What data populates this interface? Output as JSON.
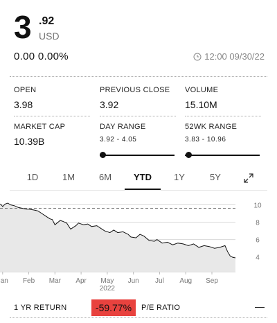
{
  "quote": {
    "price_whole": "3",
    "price_cents": ".92",
    "currency": "USD",
    "change": "0.00 0.00%",
    "timestamp": "12:00 09/30/22"
  },
  "stats": {
    "open": {
      "label": "OPEN",
      "value": "3.98"
    },
    "previous_close": {
      "label": "PREVIOUS CLOSE",
      "value": "3.92"
    },
    "volume": {
      "label": "VOLUME",
      "value": "15.10M"
    },
    "market_cap": {
      "label": "MARKET CAP",
      "value": "10.39B"
    },
    "day_range": {
      "label": "DAY RANGE",
      "value": "3.92 - 4.05",
      "position_fraction": 0.0
    },
    "week52_range": {
      "label": "52WK RANGE",
      "value": "3.83 - 10.96",
      "position_fraction": 0.01
    }
  },
  "tabs": {
    "items": [
      "1D",
      "1M",
      "6M",
      "YTD",
      "1Y",
      "5Y"
    ],
    "active": "YTD"
  },
  "icons": {
    "timestamp": "clock-icon",
    "expand": "expand-icon"
  },
  "colors": {
    "return_negative": "#e8423e",
    "line": "#111111",
    "area": "#e8e8e8"
  },
  "chart_data": {
    "type": "area",
    "xlabel": "",
    "ylabel": "",
    "x_ticks": [
      "Jan",
      "Feb",
      "Mar",
      "Apr",
      "May",
      "Jun",
      "Jul",
      "Aug",
      "Sep"
    ],
    "x_year_label": "2022",
    "y_ticks": [
      10,
      8,
      6,
      4
    ],
    "ylim": [
      2.3,
      10.6
    ],
    "grid": true,
    "reference_line": {
      "label": "previous close",
      "value": 9.6,
      "style": "dashed"
    },
    "x": [
      0,
      0.05,
      0.1,
      0.2,
      0.3,
      0.4,
      0.55,
      0.7,
      0.85,
      1.0,
      1.1,
      1.3,
      1.45,
      1.6,
      1.75,
      1.9,
      2.0,
      2.1,
      2.3,
      2.4,
      2.55,
      2.7,
      2.9,
      3.0,
      3.2,
      3.35,
      3.5,
      3.7,
      3.85,
      4.0,
      4.2,
      4.35,
      4.5,
      4.7,
      4.9,
      5.0,
      5.2,
      5.35,
      5.5,
      5.7,
      5.9,
      6.0,
      6.2,
      6.4,
      6.6,
      6.8,
      7.0,
      7.2,
      7.4,
      7.6,
      7.8,
      8.0,
      8.2,
      8.4,
      8.6,
      8.7,
      8.8,
      8.9,
      9.0
    ],
    "values": [
      10.1,
      10.0,
      9.8,
      10.1,
      10.2,
      10.0,
      9.9,
      9.7,
      9.6,
      9.5,
      9.5,
      9.4,
      9.3,
      9.0,
      8.7,
      8.4,
      8.3,
      7.7,
      8.2,
      8.1,
      7.9,
      7.2,
      7.6,
      7.9,
      7.7,
      7.8,
      7.5,
      7.6,
      7.3,
      7.0,
      6.8,
      7.1,
      6.8,
      6.9,
      6.6,
      6.3,
      6.2,
      6.6,
      6.4,
      5.9,
      5.8,
      6.0,
      5.6,
      5.7,
      5.4,
      5.6,
      5.5,
      5.3,
      5.5,
      5.1,
      5.3,
      5.2,
      5.0,
      5.1,
      5.3,
      4.6,
      4.1,
      3.95,
      3.9
    ]
  },
  "footer": {
    "return_label": "1 YR RETURN",
    "return_value": "-59.77%",
    "pe_label": "P/E RATIO",
    "pe_value": "—"
  }
}
